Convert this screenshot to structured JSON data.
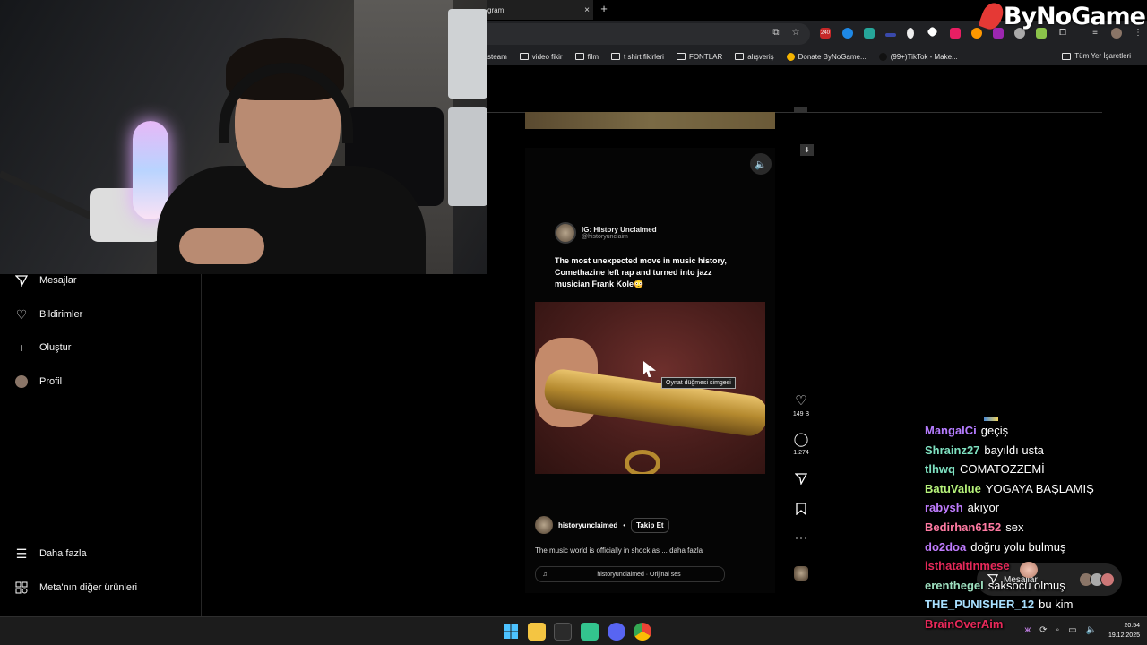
{
  "browser": {
    "tab_title": "gram",
    "tab_close": "×",
    "new_tab": "+",
    "brand": "ByNoGame",
    "bookmarks": [
      {
        "label": "steam",
        "type": "plain"
      },
      {
        "label": "video fikir",
        "type": "folder"
      },
      {
        "label": "film",
        "type": "folder"
      },
      {
        "label": "t shirt fikirleri",
        "type": "folder"
      },
      {
        "label": "FONTLAR",
        "type": "folder"
      },
      {
        "label": "alışveriş",
        "type": "folder"
      },
      {
        "label": "Donate ByNoGame...",
        "type": "site"
      },
      {
        "label": "(99+)TikTok - Make...",
        "type": "site"
      }
    ],
    "all_bookmarks": "Tüm Yer İşaretleri",
    "extension_badge": "240"
  },
  "sidebar": {
    "items": [
      {
        "label": "Mesajlar",
        "icon": "send-icon"
      },
      {
        "label": "Bildirimler",
        "icon": "heart-icon"
      },
      {
        "label": "Oluştur",
        "icon": "plus-icon"
      },
      {
        "label": "Profil",
        "icon": "avatar"
      }
    ],
    "bottom": [
      {
        "label": "Daha fazla",
        "icon": "menu-icon"
      },
      {
        "label": "Meta'nın diğer ürünleri",
        "icon": "meta-icon"
      }
    ]
  },
  "reel": {
    "post_name": "IG: History Unclaimed",
    "post_handle": "@historyunclaim",
    "post_text": "The most unexpected move in music history, Comethazine left rap and turned into jazz musician Frank Kole😳",
    "tooltip": "Oynat düğmesi simgesi",
    "author": "historyunclaimed",
    "separator": "•",
    "follow": "Takip Et",
    "caption": "The music world is officially in shock as ... daha fazla",
    "audio": "historyunclaimed · Orijinal ses",
    "mute_icon": "🔈",
    "note_icon": "♫"
  },
  "actions": {
    "likes": "149 B",
    "comments": "1.274"
  },
  "chat": [
    {
      "user": "MangalCi",
      "color": "#b57cff",
      "msg": "geçiş"
    },
    {
      "user": "Shrainz27",
      "color": "#7ee0c0",
      "msg": "bayıldı usta"
    },
    {
      "user": "tlhwq",
      "color": "#7ee0c0",
      "msg": "COMATOZZEMİ"
    },
    {
      "user": "BatuValue",
      "color": "#b6f27a",
      "msg": "YOGAYA BAŞLAMIŞ"
    },
    {
      "user": "rabysh",
      "color": "#c07cff",
      "msg": "akıyor"
    },
    {
      "user": "Bedirhan6152",
      "color": "#ff7aa2",
      "msg": "sex"
    },
    {
      "user": "do2doa",
      "color": "#c07cff",
      "msg": "doğru yolu bulmuş"
    },
    {
      "user": "isthataltinmese",
      "color": "#e8295a",
      "msg": ""
    },
    {
      "user": "erenthegel",
      "color": "#9ee0c0",
      "msg": "saksocu olmuş"
    },
    {
      "user": "THE_PUNISHER_12",
      "color": "#a9e0ff",
      "msg": "bu kim"
    },
    {
      "user": "BrainOverAim",
      "color": "#e8295a",
      "msg": ""
    }
  ],
  "messages_float": "Mesajlar",
  "taskbar": {
    "time": "20:54",
    "date": "19.12.2025"
  }
}
